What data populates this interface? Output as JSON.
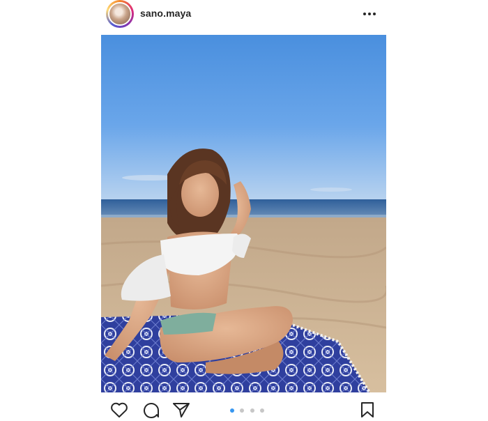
{
  "header": {
    "username": "sano.maya",
    "avatar_icon": "profile-avatar",
    "more_icon": "more-options-icon"
  },
  "photo": {
    "description_icon": "beach-photo"
  },
  "carousel": {
    "total": 4,
    "active_index": 0
  },
  "actions": {
    "like_icon": "heart-icon",
    "comment_icon": "comment-icon",
    "share_icon": "share-icon",
    "save_icon": "bookmark-icon"
  },
  "colors": {
    "accent": "#3897f0",
    "inactive_dot": "#c7c7c7",
    "text": "#262626"
  }
}
